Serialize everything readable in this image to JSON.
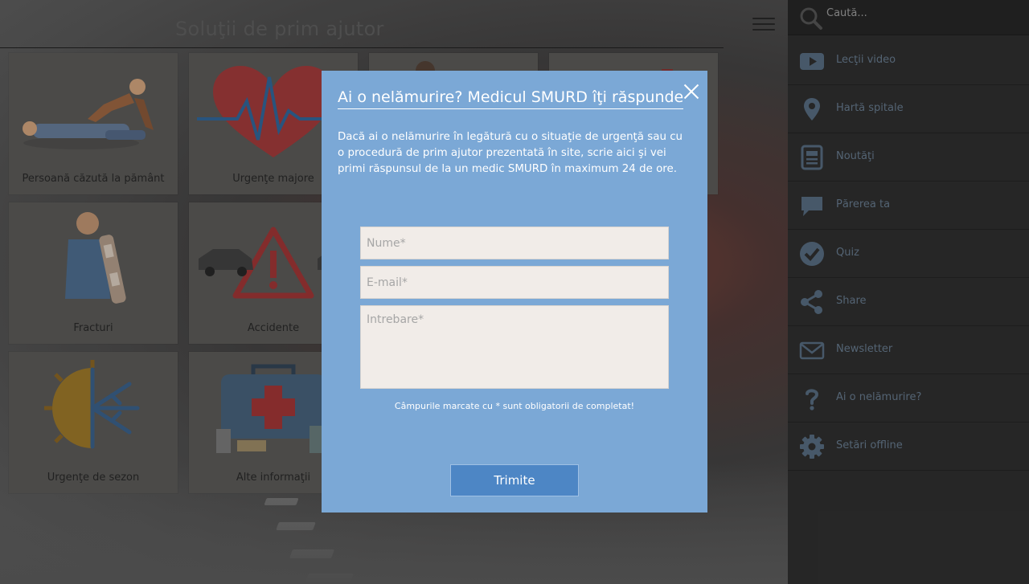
{
  "app": {
    "title": "Soluţii de prim ajutor"
  },
  "tiles": [
    {
      "label": "Persoană căzută la pământ",
      "icon": "cpr-icon"
    },
    {
      "label": "Urgenţe majore",
      "icon": "heart-pulse-icon"
    },
    {
      "label": "",
      "icon": "person-icon"
    },
    {
      "label": "",
      "icon": "first-aid-icon"
    },
    {
      "label": "Fracturi",
      "icon": "broken-arm-icon"
    },
    {
      "label": "Accidente",
      "icon": "car-accident-icon"
    },
    {
      "label": "Urgenţe de sezon",
      "icon": "sun-snow-icon"
    },
    {
      "label": "Alte informaţii",
      "icon": "medical-kit-icon"
    }
  ],
  "sidebar": {
    "search_placeholder": "Caută...",
    "items": [
      {
        "label": "Lecţii video",
        "icon": "video-icon"
      },
      {
        "label": "Hartă spitale",
        "icon": "map-pin-icon"
      },
      {
        "label": "Noutăţi",
        "icon": "news-icon"
      },
      {
        "label": "Părerea ta",
        "icon": "chat-bubble-icon"
      },
      {
        "label": "Quiz",
        "icon": "check-circle-icon"
      },
      {
        "label": "Share",
        "icon": "share-icon"
      },
      {
        "label": "Newsletter",
        "icon": "envelope-icon"
      },
      {
        "label": "Ai o nelămurire?",
        "icon": "question-icon"
      },
      {
        "label": "Setări offline",
        "icon": "gear-icon"
      }
    ]
  },
  "modal": {
    "title": "Ai o nelămurire? Medicul SMURD îţi răspunde",
    "description": "Dacă ai o nelămurire în legătură cu o situaţie de urgenţă sau cu o procedură de prim ajutor prezentată în site, scrie aici şi vei primi răspunsul de la un medic SMURD în maximum 24 de ore.",
    "name_placeholder": "Nume*",
    "email_placeholder": "E-mail*",
    "question_placeholder": "Intrebare*",
    "required_note": "Câmpurile marcate cu * sunt obligatorii de completat!",
    "submit_label": "Trimite"
  },
  "colors": {
    "modal_bg": "#7ba8d6",
    "button_bg": "#4d86c5",
    "sidebar_bg": "#292929",
    "sidebar_icon": "#4c5e70"
  }
}
